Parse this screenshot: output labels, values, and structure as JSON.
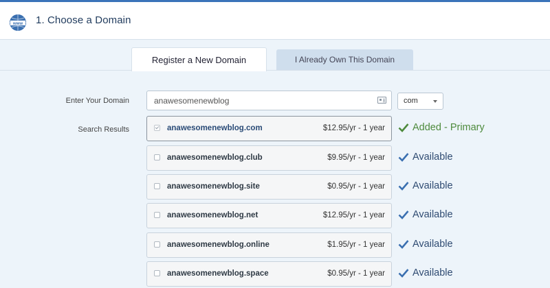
{
  "header": {
    "icon": "www-globe-icon",
    "title": "1. Choose a Domain"
  },
  "tabs": [
    {
      "label": "Register a New Domain",
      "active": true
    },
    {
      "label": "I Already Own This Domain",
      "active": false
    }
  ],
  "form": {
    "domain_label": "Enter Your Domain",
    "domain_value": "anawesomenewblog",
    "tld_value": "com",
    "results_label": "Search Results"
  },
  "results": [
    {
      "name": "anawesomenewblog.com",
      "price": "$12.95/yr - 1 year",
      "checked": true,
      "status": "Added - Primary"
    },
    {
      "name": "anawesomenewblog.club",
      "price": "$9.95/yr - 1 year",
      "checked": false,
      "status": "Available"
    },
    {
      "name": "anawesomenewblog.site",
      "price": "$0.95/yr - 1 year",
      "checked": false,
      "status": "Available"
    },
    {
      "name": "anawesomenewblog.net",
      "price": "$12.95/yr - 1 year",
      "checked": false,
      "status": "Available"
    },
    {
      "name": "anawesomenewblog.online",
      "price": "$1.95/yr - 1 year",
      "checked": false,
      "status": "Available"
    },
    {
      "name": "anawesomenewblog.space",
      "price": "$0.95/yr - 1 year",
      "checked": false,
      "status": "Available"
    }
  ],
  "colors": {
    "accent": "#3b73b9",
    "primary_status": "#4d8a3c",
    "available_status": "#2f4b72",
    "panel_bg": "#edf4fa"
  }
}
